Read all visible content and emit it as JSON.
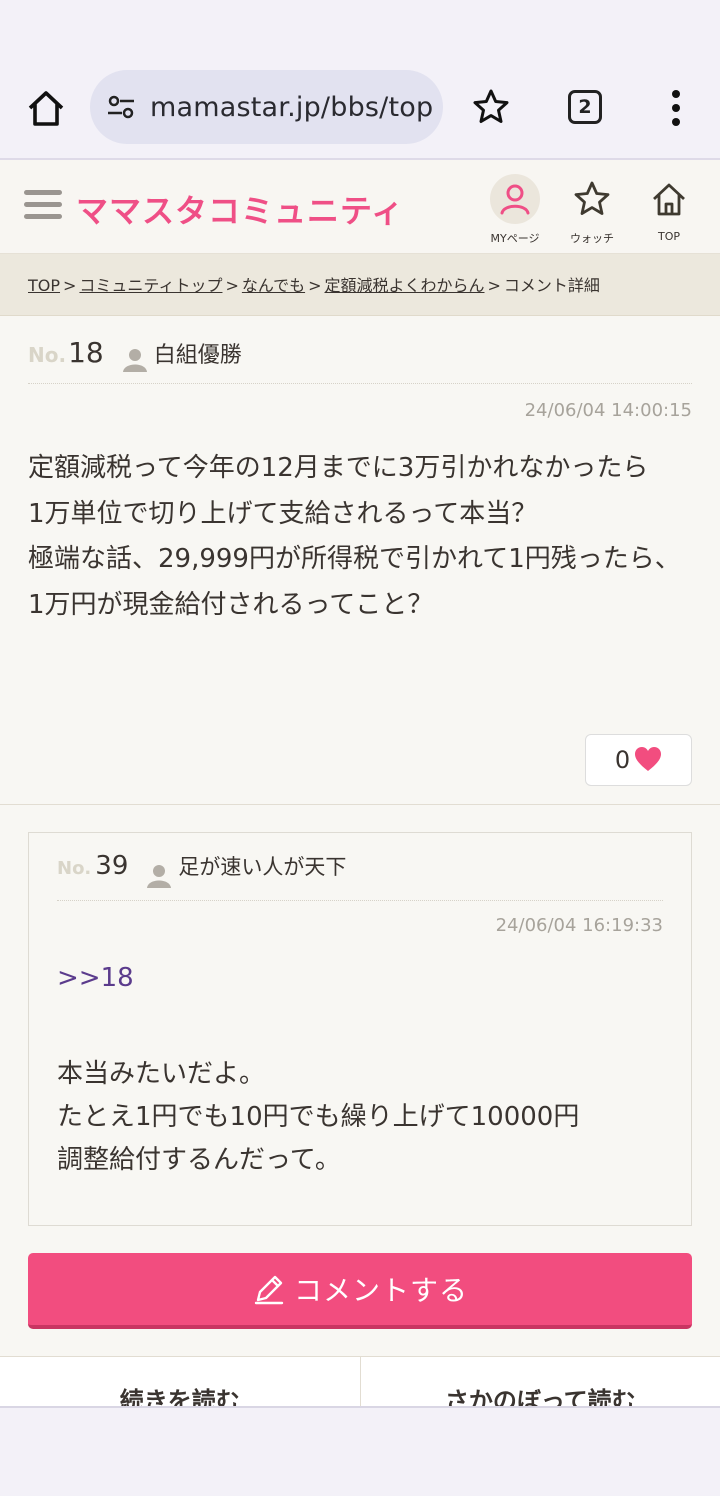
{
  "browser": {
    "url": "mamastar.jp/bbs/top",
    "tab_count": "2"
  },
  "site": {
    "logo": "ママスタコミュニティ",
    "nav": {
      "my_label": "MYページ",
      "watch_label": "ウォッチ",
      "top_label": "TOP"
    }
  },
  "breadcrumb": {
    "items": [
      "TOP",
      "コミュニティトップ",
      "なんでも",
      "定額減税よくわからん"
    ],
    "current": "コメント詳細",
    "separator": ">"
  },
  "post": {
    "no_label": "No.",
    "number": "18",
    "user": "白組優勝",
    "date": "24/06/04 14:00:15",
    "lines": [
      "定額減税って今年の12月までに3万引かれなかったら",
      "1万単位で切り上げて支給されるって本当？",
      "極端な話、29,999円が所得税で引かれて1円残ったら、",
      "1万円が現金給付されるってこと？"
    ],
    "like_count": "0"
  },
  "reply": {
    "no_label": "No.",
    "number": "39",
    "user": "足が速い人が天下",
    "date": "24/06/04 16:19:33",
    "anchor": ">>18",
    "lines": [
      "本当みたいだよ。",
      "たとえ1円でも10円でも繰り上げて10000円",
      "調整給付するんだって。"
    ]
  },
  "actions": {
    "comment_button": "コメントする",
    "read_next": "続きを読む",
    "read_back": "さかのぼって読む"
  },
  "colors": {
    "accent": "#f24d7f",
    "logo": "#ef4f86",
    "anchor": "#5b3b8c"
  }
}
